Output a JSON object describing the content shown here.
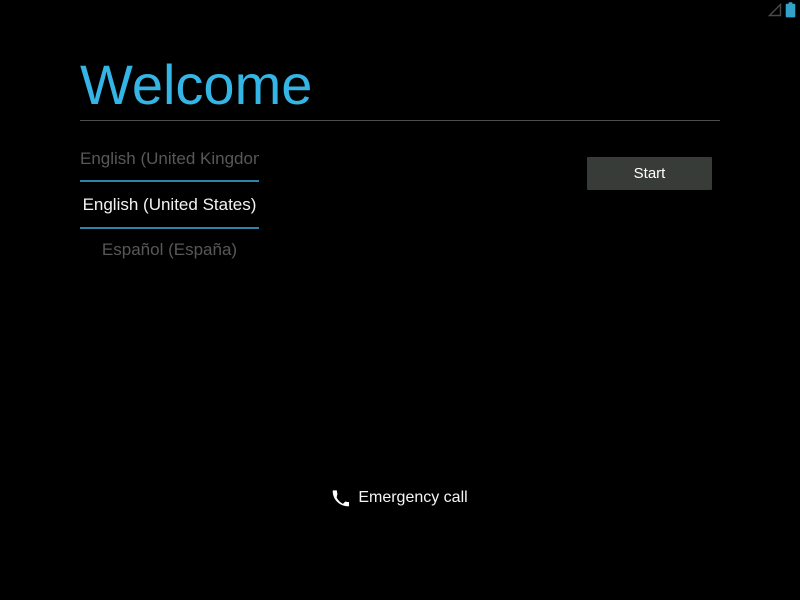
{
  "screen": {
    "name": "android-setup-welcome",
    "background_color": "#000000",
    "accent_color": "#33b5e5",
    "line_accent_color": "#2a86a8"
  },
  "status_bar": {
    "signal_icon": "signal-no-bars-icon",
    "battery_icon": "battery-full-icon",
    "battery_color": "#33a1c9",
    "signal_color": "#4a4a4a"
  },
  "header": {
    "title": "Welcome"
  },
  "locale_picker": {
    "above": "English (United Kingdom)",
    "selected": "English (United States)",
    "below": "Español (España)"
  },
  "actions": {
    "start_label": "Start",
    "start_background": "#383c38"
  },
  "footer": {
    "emergency_icon": "phone-icon",
    "emergency_label": "Emergency call"
  }
}
